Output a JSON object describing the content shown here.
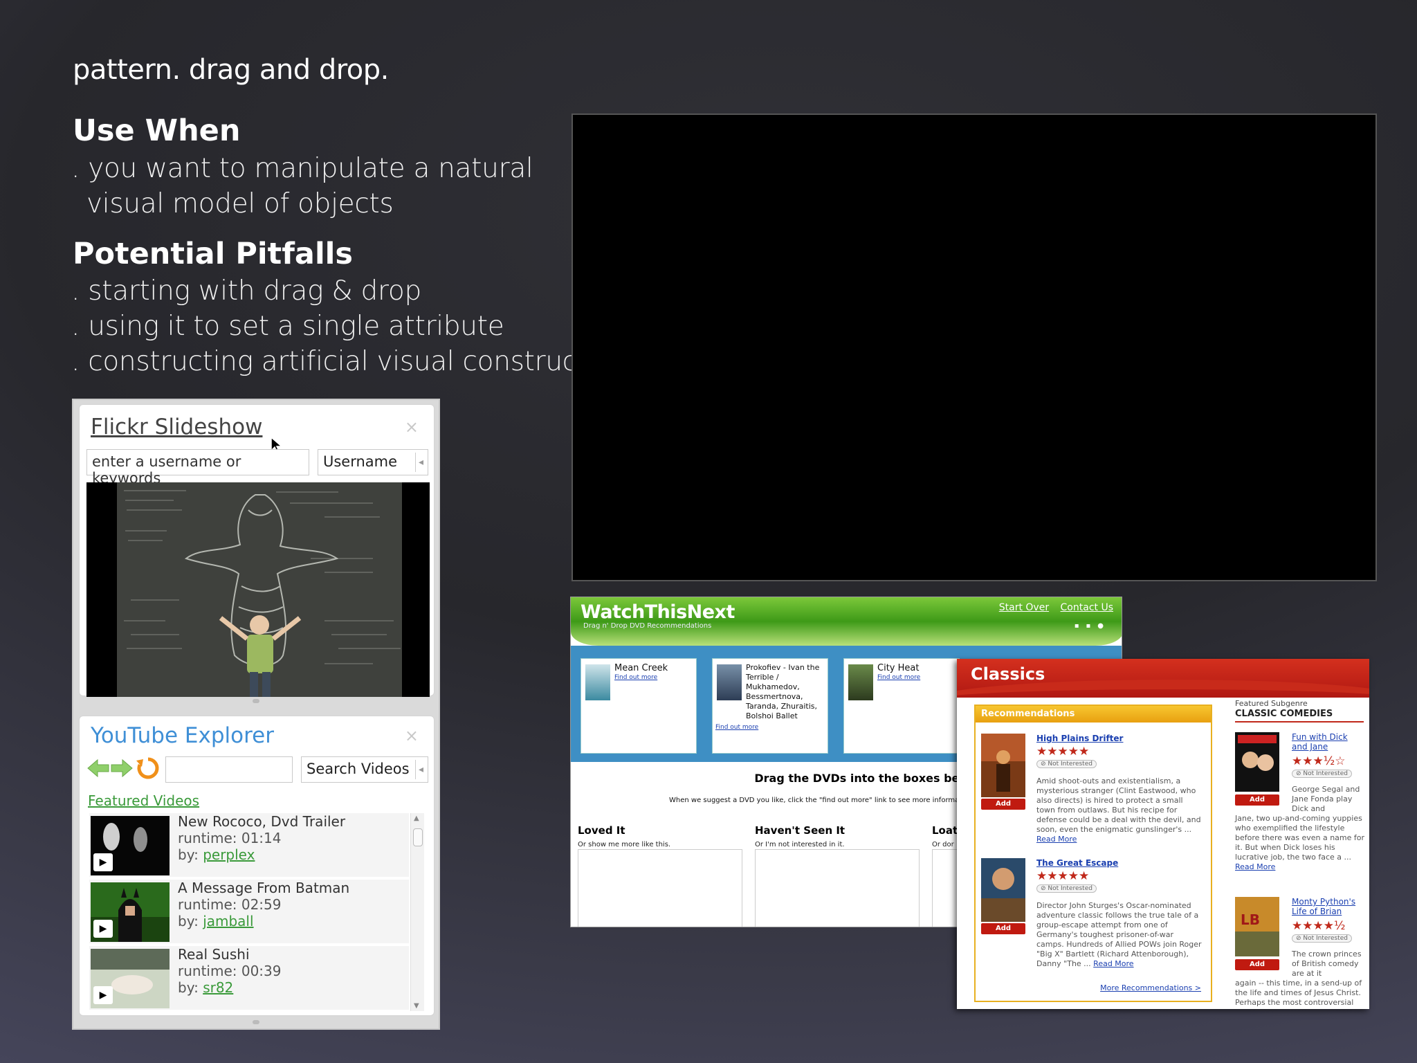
{
  "slide": {
    "title": "pattern. drag and drop.",
    "use_when_heading": "Use When",
    "use_when_items": [
      {
        "line1": "you want to manipulate a natural",
        "line2": "visual model of objects"
      }
    ],
    "pitfalls_heading": "Potential Pitfalls",
    "pitfalls_items": [
      "starting with drag & drop",
      "using it to set a single attribute",
      "constructing artificial visual constructs"
    ],
    "bullet_char": "."
  },
  "flickr": {
    "title": "Flickr Slideshow",
    "close": "×",
    "search_value": "enter a username or keywords",
    "mode": "Username",
    "caret": "◂"
  },
  "youtube": {
    "title": "YouTube Explorer",
    "close": "×",
    "search_value": "",
    "search_button": "Search Videos",
    "caret": "◂",
    "featured_link": "Featured Videos",
    "videos": [
      {
        "title": "New Rococo, Dvd Trailer",
        "runtime": "runtime: 01:14",
        "by_label": "by:",
        "author": "perplex"
      },
      {
        "title": "A Message From Batman",
        "runtime": "runtime: 02:59",
        "by_label": "by:",
        "author": "jamball"
      },
      {
        "title": "Real Sushi",
        "runtime": "runtime: 00:39",
        "by_label": "by:",
        "author": "sr82"
      }
    ]
  },
  "watchthisnext": {
    "logo": "WatchThisNext",
    "tagline": "Drag n' Drop DVD Recommendations",
    "links": [
      "Start Over",
      "Contact Us"
    ],
    "dvds": [
      {
        "name": "Mean Creek",
        "more": "Find out more"
      },
      {
        "name": "Prokofiev - Ivan the Terrible / Mukhamedov, Bessmertnova, Taranda, Zhuraitis, Bolshoi Ballet",
        "more": "Find out more"
      },
      {
        "name": "City Heat",
        "more": "Find out more"
      }
    ],
    "instruction": "Drag the DVDs into the boxes below",
    "instruction_sub": "When we suggest a DVD you like, click the \"find out more\" link to see more informati",
    "bins": [
      {
        "title": "Loved It",
        "sub": "Or show me more like this."
      },
      {
        "title": "Haven't Seen It",
        "sub": "Or I'm not interested in it."
      },
      {
        "title": "Loath",
        "sub": "Or dor"
      }
    ]
  },
  "classics": {
    "title": "Classics",
    "rec_heading": "Recommendations",
    "add_label": "Add",
    "not_interested": "⊘ Not Interested",
    "read_more": "Read More",
    "more_recs": "More Recommendations >",
    "recs": [
      {
        "title": "High Plains Drifter",
        "stars": "★★★★★",
        "desc": "Amid shoot-outs and existentialism, a mysterious stranger (Clint Eastwood, who also directs) is hired to protect a small town from outlaws. But his recipe for defense could be a deal with the devil, and soon, even the enigmatic gunslinger's ..."
      },
      {
        "title": "The Great Escape",
        "stars": "★★★★★",
        "desc": "Director John Sturges's Oscar-nominated adventure classic follows the true tale of a group-escape attempt from one of Germany's toughest prisoner-of-war camps. Hundreds of Allied POWs join Roger \"Big X\" Bartlett (Richard Attenborough), Danny \"The ..."
      }
    ],
    "subgenre_label": "Featured Subgenre",
    "subgenre_name": "CLASSIC COMEDIES",
    "featured": [
      {
        "title": "Fun with Dick and Jane",
        "stars": "★★★½☆",
        "desc_side": "George Segal and Jane Fonda play Dick and",
        "desc_full": "Jane, two up-and-coming yuppies who exemplified the lifestyle before there was even a name for it. But when Dick loses his lucrative job, the two face a ..."
      },
      {
        "title": "Monty Python's Life of Brian",
        "stars": "★★★★½",
        "desc_side": "The crown princes of British comedy are at it",
        "desc_full": "again -- this time, in a send-up of the life and times of Jesus Christ. Perhaps the most controversial"
      }
    ]
  },
  "colors": {
    "youtube_blue": "#3f8fd6",
    "link_green": "#3a9a3a",
    "wtn_green": "#3e9a18",
    "classics_red": "#c0281a",
    "rec_gold": "#e8b020"
  }
}
